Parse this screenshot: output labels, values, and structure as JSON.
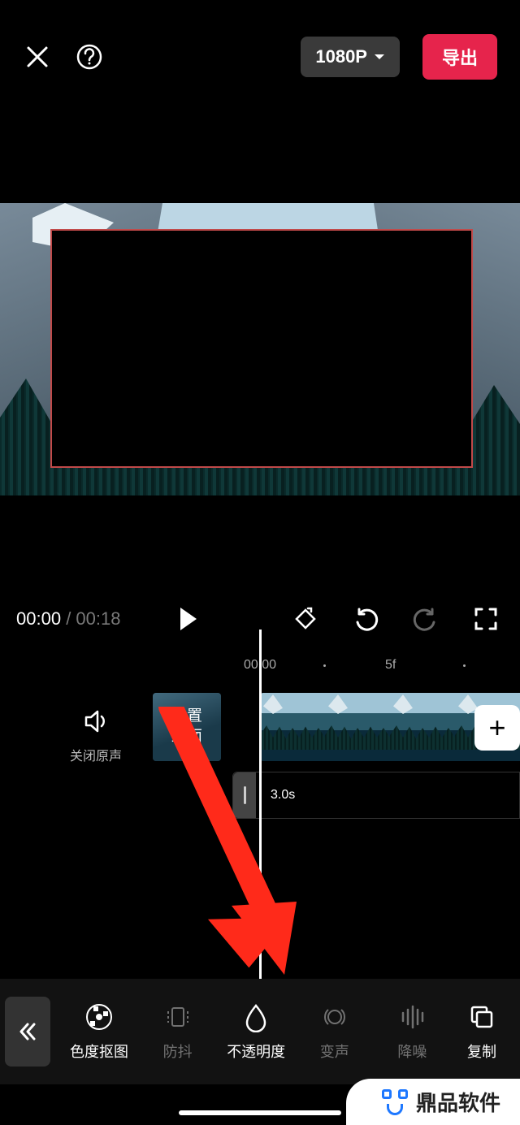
{
  "header": {
    "resolution": "1080P",
    "export": "导出"
  },
  "time": {
    "current": "00:00",
    "total": "00:18"
  },
  "ruler": {
    "t0": "00:00",
    "t5": "5f"
  },
  "mute_label": "关闭原声",
  "cover_label": "设置\n封面",
  "clip_duration": "3.0s",
  "toolbar": {
    "items": [
      {
        "label": "色度抠图",
        "dim": false
      },
      {
        "label": "防抖",
        "dim": true
      },
      {
        "label": "不透明度",
        "dim": false
      },
      {
        "label": "变声",
        "dim": true
      },
      {
        "label": "降噪",
        "dim": true
      },
      {
        "label": "复制",
        "dim": false
      }
    ]
  },
  "watermark": "鼎品软件"
}
